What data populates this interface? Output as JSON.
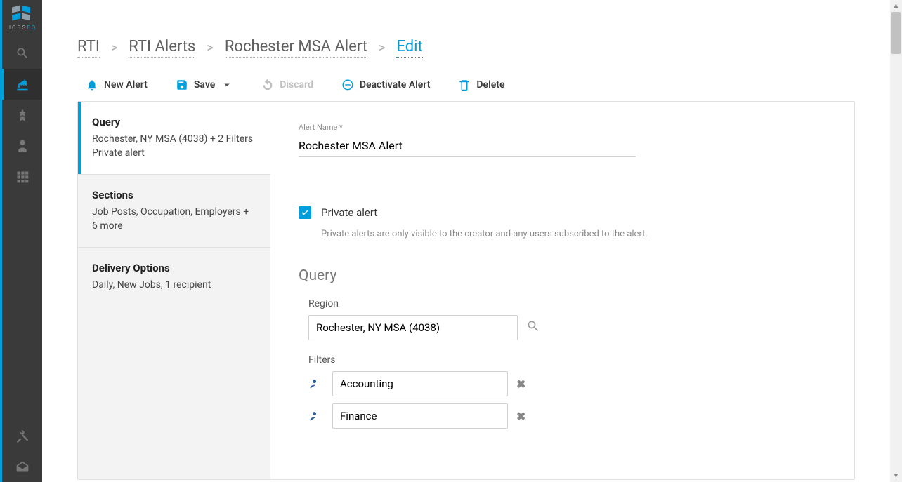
{
  "logo_text_a": "JOBS",
  "logo_text_b": "EQ",
  "breadcrumb": {
    "items": [
      {
        "label": "RTI"
      },
      {
        "label": "RTI Alerts"
      },
      {
        "label": "Rochester MSA Alert"
      },
      {
        "label": "Edit",
        "active": true
      }
    ],
    "sep": ">"
  },
  "actions": {
    "new_alert": "New Alert",
    "save": "Save",
    "discard": "Discard",
    "deactivate": "Deactivate Alert",
    "delete": "Delete"
  },
  "side": {
    "query": {
      "title": "Query",
      "line1": "Rochester, NY MSA (4038) + 2 Filters",
      "line2": "Private alert"
    },
    "sections": {
      "title": "Sections",
      "line1": "Job Posts, Occupation, Employers  + 6 more"
    },
    "delivery": {
      "title": "Delivery Options",
      "line1": "Daily, New Jobs, 1 recipient"
    }
  },
  "form": {
    "alert_name_label": "Alert Name *",
    "alert_name_value": "Rochester MSA Alert",
    "private_label": "Private alert",
    "private_help": "Private alerts are only visible to the creator and any users subscribed to the alert.",
    "query_heading": "Query",
    "region_label": "Region",
    "region_value": "Rochester, NY MSA (4038)",
    "filters_label": "Filters",
    "filters": [
      {
        "value": "Accounting"
      },
      {
        "value": "Finance"
      }
    ]
  }
}
